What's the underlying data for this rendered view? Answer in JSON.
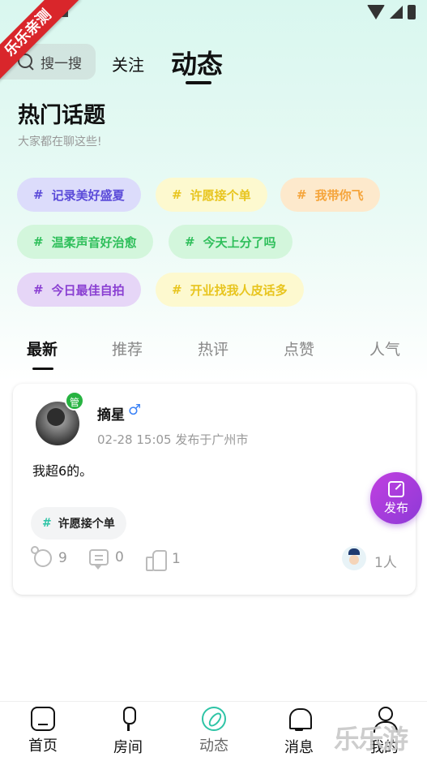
{
  "ribbon": {
    "text": "乐乐亲测"
  },
  "header": {
    "search_placeholder": "搜一搜",
    "tab_follow": "关注",
    "tab_active": "动态"
  },
  "topics": {
    "title": "热门话题",
    "subtitle": "大家都在聊这些!",
    "items": [
      {
        "label": "记录美好盛夏",
        "hash": "#",
        "bg": "#dcdcfb",
        "color": "#5b4bd9"
      },
      {
        "label": "许愿接个单",
        "hash": "#",
        "bg": "#fdf9cf",
        "color": "#e8c51f"
      },
      {
        "label": "我带你飞",
        "hash": "#",
        "bg": "#fde9cc",
        "color": "#f5a43a"
      },
      {
        "label": "温柔声音好治愈",
        "hash": "#",
        "bg": "#d3f6dc",
        "color": "#2fbf5b"
      },
      {
        "label": "今天上分了吗",
        "hash": "#",
        "bg": "#d3f6dc",
        "color": "#2fbf5b"
      },
      {
        "label": "今日最佳自拍",
        "hash": "#",
        "bg": "#e6d6f7",
        "color": "#8a3fd2"
      },
      {
        "label": "开业找我人皮话多",
        "hash": "#",
        "bg": "#fdf9cf",
        "color": "#e8c51f"
      }
    ]
  },
  "sort_tabs": [
    "最新",
    "推荐",
    "热评",
    "点赞",
    "人气"
  ],
  "post": {
    "admin_badge": "管",
    "user_name": "摘星",
    "gender_symbol": "♂",
    "meta": "02-28 15:05 发布于广州市",
    "text": "我超6的。",
    "tag_hash": "#",
    "tag": "许愿接个单",
    "gift_count": "9",
    "comment_count": "0",
    "like_count": "1",
    "viewer_count": "1人"
  },
  "fab": {
    "label": "发布"
  },
  "bottom_nav": [
    {
      "label": "首页",
      "icon": "home-icon"
    },
    {
      "label": "房间",
      "icon": "mic-icon"
    },
    {
      "label": "动态",
      "icon": "compass-icon"
    },
    {
      "label": "消息",
      "icon": "bell-icon"
    },
    {
      "label": "我的",
      "icon": "user-icon"
    }
  ],
  "watermark": "乐乐游戏",
  "colors": {
    "accent": "#2ec4a6",
    "fab": "#b13fdc"
  }
}
